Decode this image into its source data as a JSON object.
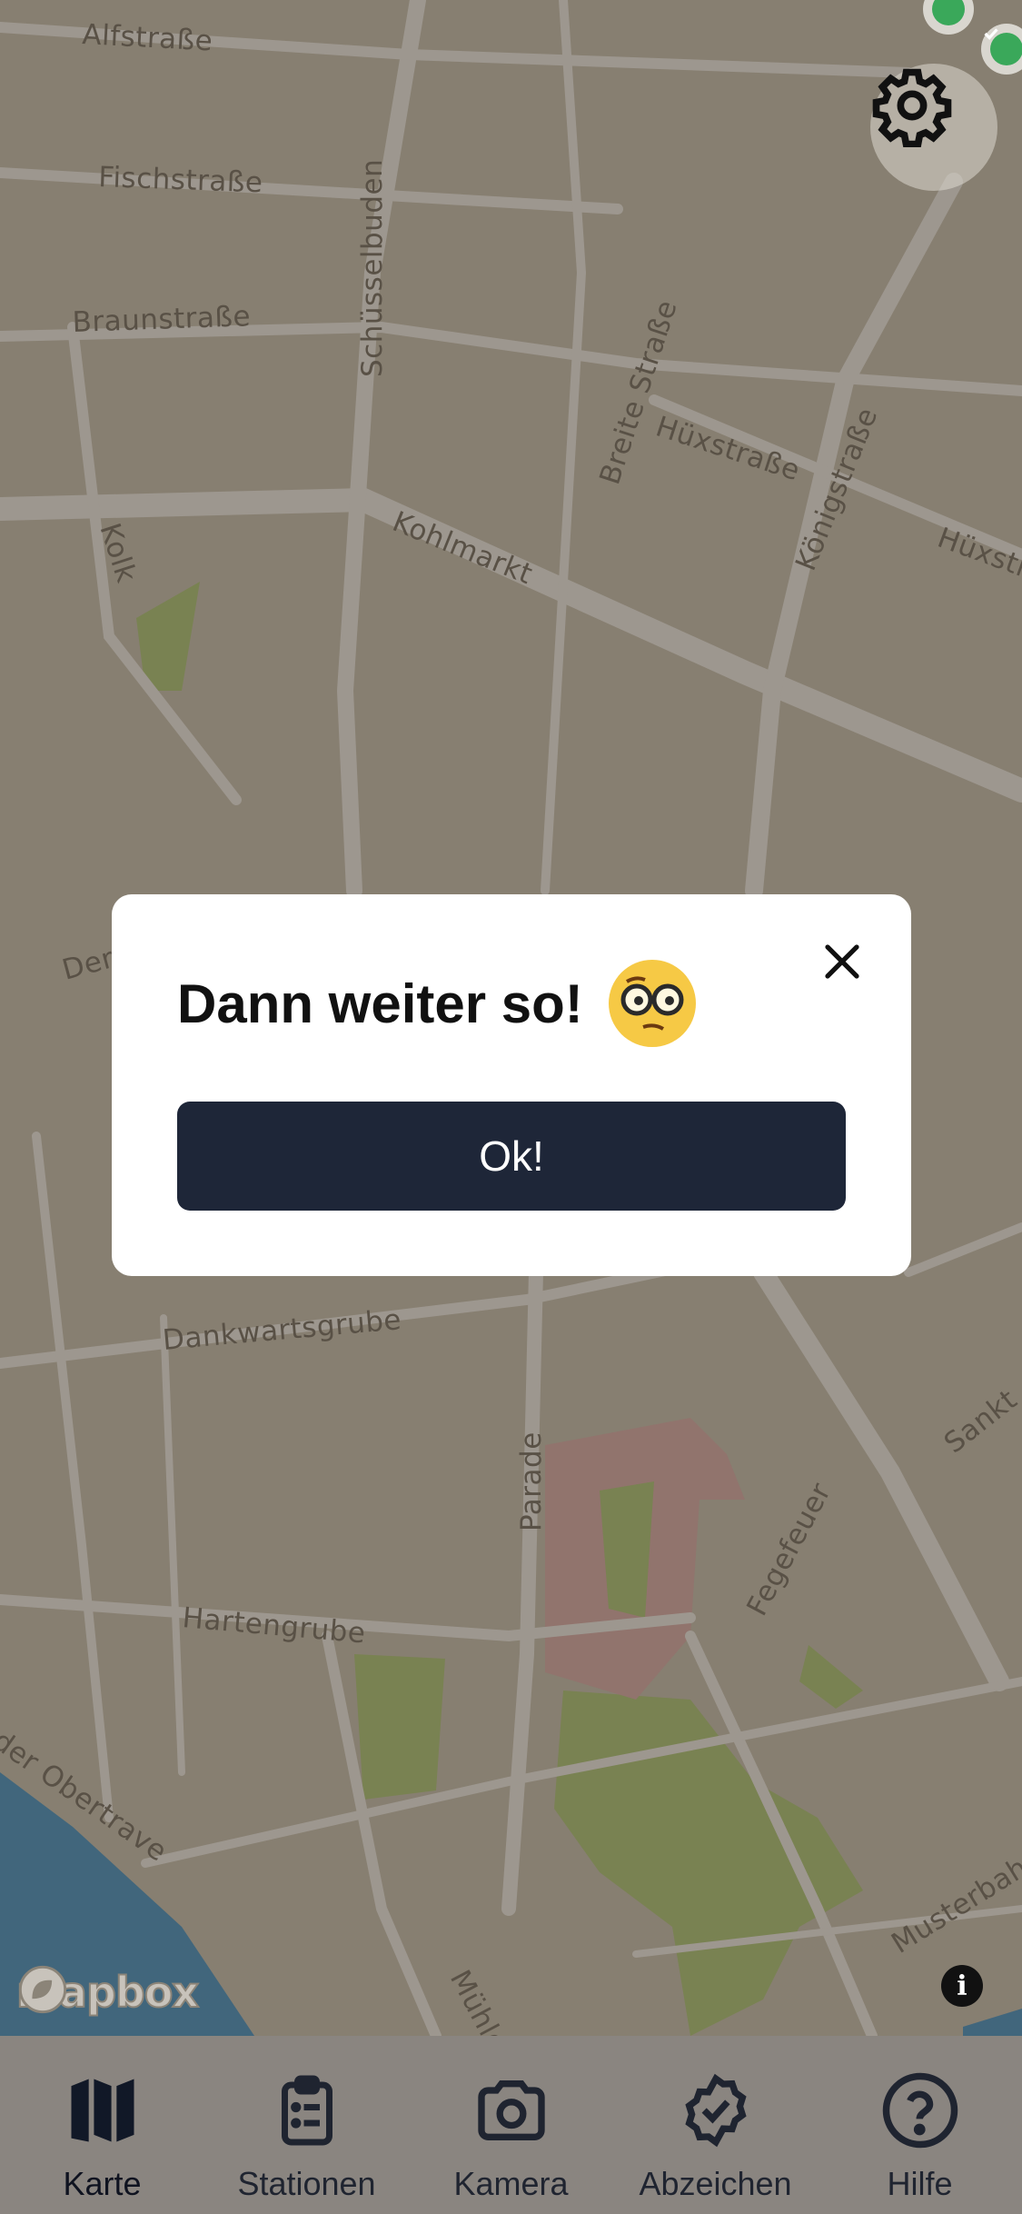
{
  "map": {
    "streets": [
      "Alfstraße",
      "Fischstraße",
      "Braunstraße",
      "Schüsselbuden",
      "Breite Straße",
      "Hüxstraße",
      "Königstraße",
      "Hüxstr",
      "Kolk",
      "Kohlmarkt",
      "Der",
      "Dankwartsgrube",
      "Parade",
      "Sankt",
      "Fegefeuer",
      "Hartengrube",
      "der Obertrave",
      "Musterbahn",
      "Mühle"
    ],
    "attribution": "mapbox",
    "info_label": "i",
    "colors": {
      "background": "#c3bba9",
      "road": "#d9d6d1",
      "park": "#9fbf7c",
      "water": "#4f8ab0",
      "landmark": "#c79e98"
    }
  },
  "settings": {
    "icon": "gear-icon"
  },
  "modal": {
    "title": "Dann weiter so!",
    "emoji": "🧐",
    "ok_label": "Ok!",
    "close_icon": "close-icon"
  },
  "tabs": [
    {
      "label": "Karte",
      "icon": "map-icon",
      "active": true
    },
    {
      "label": "Stationen",
      "icon": "clipboard-list-icon",
      "active": false
    },
    {
      "label": "Kamera",
      "icon": "camera-icon",
      "active": false
    },
    {
      "label": "Abzeichen",
      "icon": "badge-check-icon",
      "active": false
    },
    {
      "label": "Hilfe",
      "icon": "help-icon",
      "active": false
    }
  ]
}
